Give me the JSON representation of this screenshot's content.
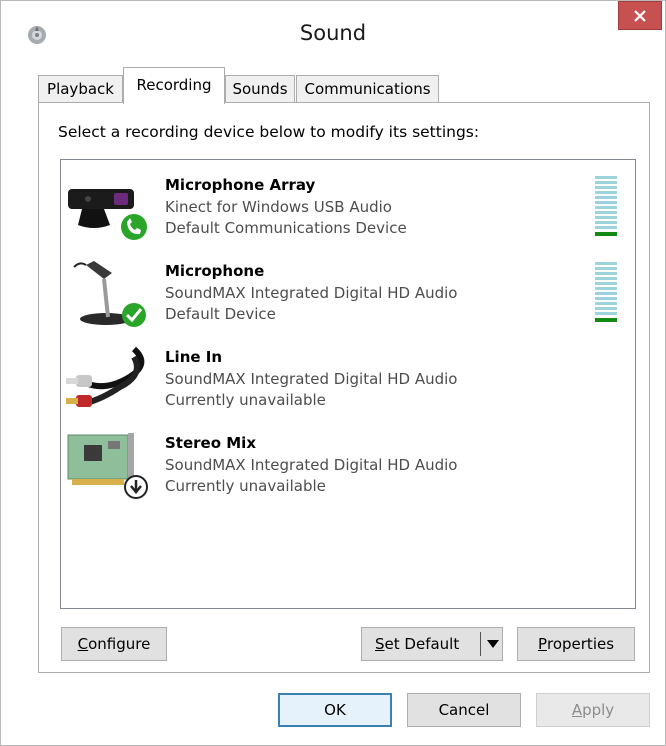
{
  "window": {
    "title": "Sound"
  },
  "tabs": [
    {
      "label": "Playback"
    },
    {
      "label": "Recording"
    },
    {
      "label": "Sounds"
    },
    {
      "label": "Communications"
    }
  ],
  "active_tab": "Recording",
  "instruction": "Select a recording device below to modify its settings:",
  "devices": [
    {
      "name": "Microphone Array",
      "driver": "Kinect for Windows USB Audio",
      "status": "Default Communications Device",
      "icon": "kinect-sensor-icon",
      "badge": "phone-check-badge",
      "level_meter": true
    },
    {
      "name": "Microphone",
      "driver": "SoundMAX Integrated Digital HD Audio",
      "status": "Default Device",
      "icon": "microphone-icon",
      "badge": "check-badge",
      "level_meter": true
    },
    {
      "name": "Line In",
      "driver": "SoundMAX Integrated Digital HD Audio",
      "status": "Currently unavailable",
      "icon": "rca-cable-icon",
      "badge": null,
      "level_meter": false
    },
    {
      "name": "Stereo Mix",
      "driver": "SoundMAX Integrated Digital HD Audio",
      "status": "Currently unavailable",
      "icon": "sound-card-icon",
      "badge": "down-arrow-badge",
      "level_meter": false
    }
  ],
  "buttons": {
    "configure": {
      "first": "C",
      "rest": "onfigure"
    },
    "set_default": {
      "first": "S",
      "rest": "et Default"
    },
    "properties": {
      "first": "P",
      "rest": "roperties"
    },
    "ok": "OK",
    "cancel": "Cancel",
    "apply": {
      "first": "A",
      "rest": "pply"
    }
  },
  "colors": {
    "close_button": "#c75050",
    "meter_bar": "#9cd3dc",
    "meter_level": "#138a13",
    "check_badge": "#2aa52a"
  }
}
